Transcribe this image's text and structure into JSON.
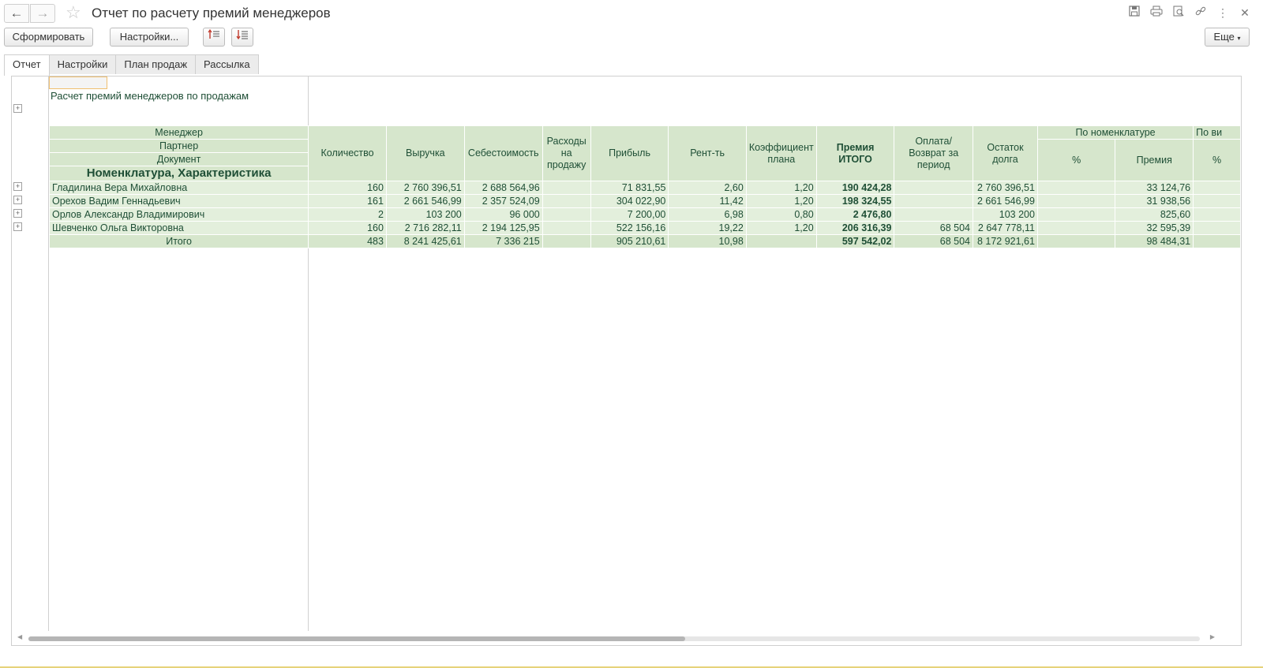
{
  "window": {
    "title": "Отчет по расчету премий менеджеров"
  },
  "toolbar": {
    "generate": "Сформировать",
    "settings": "Настройки...",
    "more": "Еще"
  },
  "icons": {
    "back": "arrow-left-icon",
    "forward": "arrow-right-icon",
    "favorite": "star-icon",
    "save": "save-icon",
    "print": "print-icon",
    "preview": "preview-icon",
    "link": "link-icon",
    "menu": "more-vertical-icon",
    "close": "close-icon"
  },
  "tabs": [
    {
      "label": "Отчет",
      "active": true
    },
    {
      "label": "Настройки",
      "active": false
    },
    {
      "label": "План продаж",
      "active": false
    },
    {
      "label": "Рассылка",
      "active": false
    }
  ],
  "report": {
    "title": "Расчет премий менеджеров по продажам",
    "group_headers": [
      "Менеджер",
      "Партнер",
      "Документ",
      "Номенклатура, Характеристика"
    ],
    "columns": {
      "qty": "Количество",
      "revenue": "Выручка",
      "cost": "Себестоимость",
      "expenses": "Расходы на продажу",
      "profit": "Прибыль",
      "rent": "Рент-ть",
      "coef": "Коэффициент плана",
      "bonus_total": "Премия ИТОГО",
      "payment": "Оплата/Возврат за период",
      "debt": "Остаток долга",
      "by_nomenclature": "По номенклатуре",
      "by_nom_pct": "%",
      "by_nom_bonus": "Премия",
      "by_type": "По ви",
      "by_type_pct": "%"
    },
    "rows": [
      {
        "name": "Гладилина Вера Михайловна",
        "qty": "160",
        "revenue": "2 760 396,51",
        "cost": "2 688 564,96",
        "expenses": "",
        "profit": "71 831,55",
        "rent": "2,60",
        "coef": "1,20",
        "bonus_total": "190 424,28",
        "payment": "",
        "debt": "2 760 396,51",
        "pct": "",
        "bonus": "33 124,76",
        "pct2": ""
      },
      {
        "name": "Орехов Вадим Геннадьевич",
        "qty": "161",
        "revenue": "2 661 546,99",
        "cost": "2 357 524,09",
        "expenses": "",
        "profit": "304 022,90",
        "rent": "11,42",
        "coef": "1,20",
        "bonus_total": "198 324,55",
        "payment": "",
        "debt": "2 661 546,99",
        "pct": "",
        "bonus": "31 938,56",
        "pct2": ""
      },
      {
        "name": "Орлов Александр Владимирович",
        "qty": "2",
        "revenue": "103 200",
        "cost": "96 000",
        "expenses": "",
        "profit": "7 200,00",
        "rent": "6,98",
        "coef": "0,80",
        "bonus_total": "2 476,80",
        "payment": "",
        "debt": "103 200",
        "pct": "",
        "bonus": "825,60",
        "pct2": ""
      },
      {
        "name": "Шевченко Ольга Викторовна",
        "qty": "160",
        "revenue": "2 716 282,11",
        "cost": "2 194 125,95",
        "expenses": "",
        "profit": "522 156,16",
        "rent": "19,22",
        "coef": "1,20",
        "bonus_total": "206 316,39",
        "payment": "68 504",
        "debt": "2 647 778,11",
        "pct": "",
        "bonus": "32 595,39",
        "pct2": ""
      }
    ],
    "total": {
      "name": "Итого",
      "qty": "483",
      "revenue": "8 241 425,61",
      "cost": "7 336 215",
      "expenses": "",
      "profit": "905 210,61",
      "rent": "10,98",
      "coef": "",
      "bonus_total": "597 542,02",
      "payment": "68 504",
      "debt": "8 172 921,61",
      "pct": "",
      "bonus": "98 484,31",
      "pct2": ""
    }
  }
}
